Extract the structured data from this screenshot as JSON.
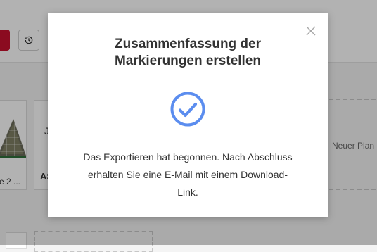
{
  "background": {
    "card1_label": "e 2 ...",
    "card2_letter": "J",
    "card2_label": "AS",
    "new_plan_label": "Neuer Plan"
  },
  "dialog": {
    "title_line1": "Zusammenfassung der",
    "title_line2": "Markierungen erstellen",
    "message_line1": "Das Exportieren hat begonnen. Nach Abschluss",
    "message_line2": "erhalten Sie eine E-Mail mit einem Download-",
    "message_line3": "Link.",
    "icon": "check-circle-icon",
    "accent_color": "#5b8def"
  },
  "colors": {
    "brand_red": "#c8102e",
    "overlay": "rgba(0,0,0,0.30)"
  }
}
